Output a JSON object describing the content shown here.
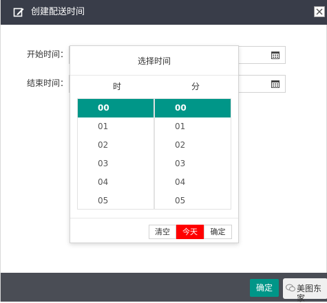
{
  "dialog": {
    "title": "创建配送时间",
    "header_icon": "edit-icon",
    "close_icon": "close-icon"
  },
  "form": {
    "start_label": "开始时间：",
    "end_label": "结束时间：",
    "calendar_icon": "calendar-icon"
  },
  "picker": {
    "title": "选择时间",
    "hour_header": "时",
    "minute_header": "分",
    "hours": [
      "00",
      "01",
      "02",
      "03",
      "04",
      "05"
    ],
    "minutes": [
      "00",
      "01",
      "02",
      "03",
      "04",
      "05"
    ],
    "selected_hour": "00",
    "selected_minute": "00",
    "clear_label": "清空",
    "today_label": "今天",
    "ok_label": "确定"
  },
  "footer": {
    "confirm_label": "确定",
    "watermark_text": "美图东家"
  },
  "colors": {
    "header_bg": "#393d49",
    "accent": "#009688",
    "today_button": "#ff0000"
  }
}
